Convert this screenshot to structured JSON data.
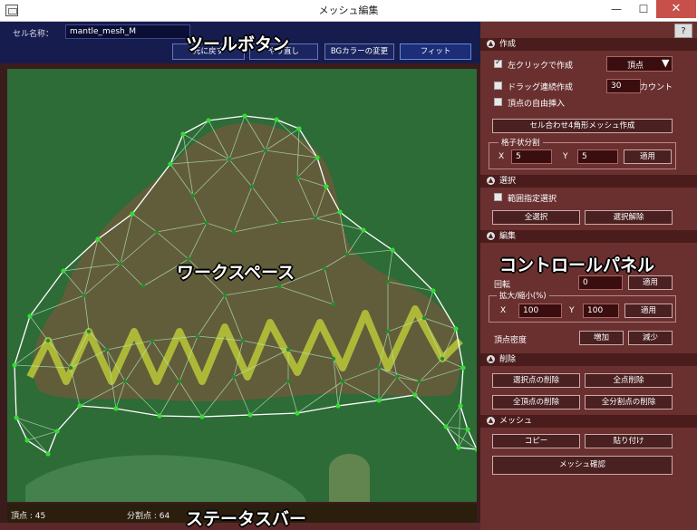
{
  "window": {
    "title": "メッシュ編集",
    "minimize": "—",
    "maximize": "☐",
    "close": "✕"
  },
  "topbar": {
    "cell_name_label": "セル名称：",
    "cell_name_value": "mantle_mesh_M",
    "undo_label": "元に戻す",
    "redo_label": "やり直し",
    "bg_color_label": "BGカラーの変更",
    "fit_label": "フィット"
  },
  "annotations": {
    "tool_buttons": "ツールボタン",
    "workspace": "ワークスペース",
    "control_panel": "コントロールパネル",
    "status_bar": "ステータスバー"
  },
  "status": {
    "vertices": "頂点 : 45",
    "divisions": "分割点 : 64"
  },
  "panel": {
    "help_label": "?",
    "create": {
      "header": "作成",
      "left_click_create": "左クリックで作成",
      "mode_value": "頂点",
      "drag_continuous": "ドラッグ連続作成",
      "count_value": "30",
      "count_label": "カウント",
      "free_insert": "頂点の自由挿入",
      "quad_mesh_button": "セル合わせ4角形メッシュ作成",
      "grid_title": "格子状分割",
      "x_label": "X",
      "x_value": "5",
      "y_label": "Y",
      "y_value": "5",
      "apply_label": "適用"
    },
    "select": {
      "header": "選択",
      "range_select": "範囲指定選択",
      "select_all": "全選択",
      "deselect": "選択解除"
    },
    "edit": {
      "header": "編集",
      "rotate_label": "回転",
      "rotate_value": "0",
      "apply_label": "適用",
      "scale_title": "拡大/縮小(%)",
      "x_label": "X",
      "x_value": "100",
      "y_label": "Y",
      "y_value": "100",
      "density_label": "頂点密度",
      "increase": "増加",
      "decrease": "減少"
    },
    "delete": {
      "header": "削除",
      "delete_selected": "選択点の削除",
      "delete_all_points": "全点削除",
      "delete_all_vertices": "全頂点の削除",
      "delete_all_divisions": "全分割点の削除"
    },
    "mesh": {
      "header": "メッシュ",
      "copy": "コピー",
      "paste": "貼り付け",
      "confirm": "メッシュ確認"
    }
  },
  "colors": {
    "workspace_bg": "#2d6b37",
    "panel_bg": "#6a3030",
    "toolbar_bg": "#161c4e",
    "vertex": "#33dd33",
    "division_point": "#1f8f2a",
    "mesh_line": "#b8e8b8"
  }
}
